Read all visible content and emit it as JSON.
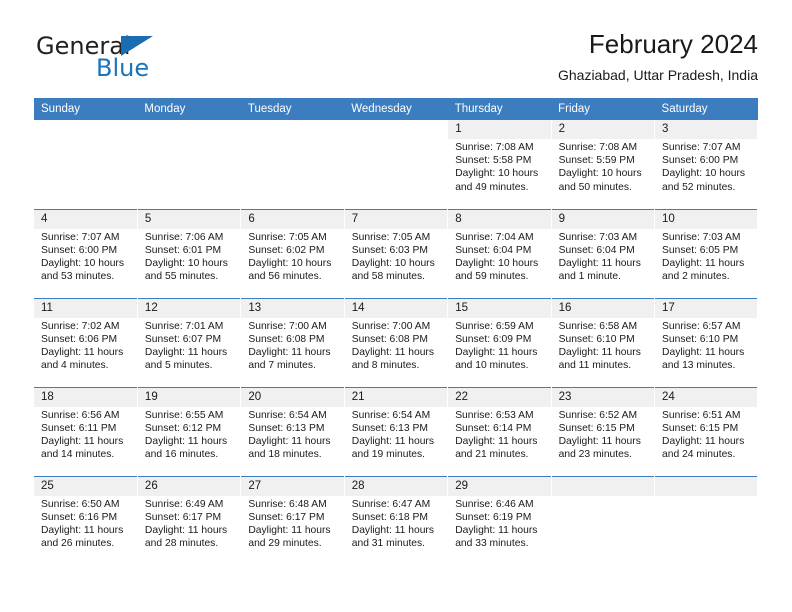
{
  "brand": {
    "word1": "General",
    "word2": "Blue",
    "flag_icon": "triangle-flag-icon",
    "accent_color": "#1b6cb0"
  },
  "header": {
    "title": "February 2024",
    "subtitle": "Ghaziabad, Uttar Pradesh, India"
  },
  "theme": {
    "header_blue": "#3b7dbf",
    "date_band_gray": "#f0f0f0",
    "divider_blue": "#3b7dbf",
    "text": "#1a1a1a"
  },
  "weekday_headers": [
    "Sunday",
    "Monday",
    "Tuesday",
    "Wednesday",
    "Thursday",
    "Friday",
    "Saturday"
  ],
  "weeks": [
    [
      {
        "date": "",
        "blank": true,
        "lines": []
      },
      {
        "date": "",
        "blank": true,
        "lines": []
      },
      {
        "date": "",
        "blank": true,
        "lines": []
      },
      {
        "date": "",
        "blank": true,
        "lines": []
      },
      {
        "date": "1",
        "lines": [
          "Sunrise: 7:08 AM",
          "Sunset: 5:58 PM",
          "Daylight: 10 hours",
          "and 49 minutes."
        ]
      },
      {
        "date": "2",
        "lines": [
          "Sunrise: 7:08 AM",
          "Sunset: 5:59 PM",
          "Daylight: 10 hours",
          "and 50 minutes."
        ]
      },
      {
        "date": "3",
        "lines": [
          "Sunrise: 7:07 AM",
          "Sunset: 6:00 PM",
          "Daylight: 10 hours",
          "and 52 minutes."
        ]
      }
    ],
    [
      {
        "date": "4",
        "lines": [
          "Sunrise: 7:07 AM",
          "Sunset: 6:00 PM",
          "Daylight: 10 hours",
          "and 53 minutes."
        ]
      },
      {
        "date": "5",
        "lines": [
          "Sunrise: 7:06 AM",
          "Sunset: 6:01 PM",
          "Daylight: 10 hours",
          "and 55 minutes."
        ]
      },
      {
        "date": "6",
        "lines": [
          "Sunrise: 7:05 AM",
          "Sunset: 6:02 PM",
          "Daylight: 10 hours",
          "and 56 minutes."
        ]
      },
      {
        "date": "7",
        "lines": [
          "Sunrise: 7:05 AM",
          "Sunset: 6:03 PM",
          "Daylight: 10 hours",
          "and 58 minutes."
        ]
      },
      {
        "date": "8",
        "lines": [
          "Sunrise: 7:04 AM",
          "Sunset: 6:04 PM",
          "Daylight: 10 hours",
          "and 59 minutes."
        ]
      },
      {
        "date": "9",
        "lines": [
          "Sunrise: 7:03 AM",
          "Sunset: 6:04 PM",
          "Daylight: 11 hours",
          "and 1 minute."
        ]
      },
      {
        "date": "10",
        "lines": [
          "Sunrise: 7:03 AM",
          "Sunset: 6:05 PM",
          "Daylight: 11 hours",
          "and 2 minutes."
        ]
      }
    ],
    [
      {
        "date": "11",
        "lines": [
          "Sunrise: 7:02 AM",
          "Sunset: 6:06 PM",
          "Daylight: 11 hours",
          "and 4 minutes."
        ]
      },
      {
        "date": "12",
        "lines": [
          "Sunrise: 7:01 AM",
          "Sunset: 6:07 PM",
          "Daylight: 11 hours",
          "and 5 minutes."
        ]
      },
      {
        "date": "13",
        "lines": [
          "Sunrise: 7:00 AM",
          "Sunset: 6:08 PM",
          "Daylight: 11 hours",
          "and 7 minutes."
        ]
      },
      {
        "date": "14",
        "lines": [
          "Sunrise: 7:00 AM",
          "Sunset: 6:08 PM",
          "Daylight: 11 hours",
          "and 8 minutes."
        ]
      },
      {
        "date": "15",
        "lines": [
          "Sunrise: 6:59 AM",
          "Sunset: 6:09 PM",
          "Daylight: 11 hours",
          "and 10 minutes."
        ]
      },
      {
        "date": "16",
        "lines": [
          "Sunrise: 6:58 AM",
          "Sunset: 6:10 PM",
          "Daylight: 11 hours",
          "and 11 minutes."
        ]
      },
      {
        "date": "17",
        "lines": [
          "Sunrise: 6:57 AM",
          "Sunset: 6:10 PM",
          "Daylight: 11 hours",
          "and 13 minutes."
        ]
      }
    ],
    [
      {
        "date": "18",
        "lines": [
          "Sunrise: 6:56 AM",
          "Sunset: 6:11 PM",
          "Daylight: 11 hours",
          "and 14 minutes."
        ]
      },
      {
        "date": "19",
        "lines": [
          "Sunrise: 6:55 AM",
          "Sunset: 6:12 PM",
          "Daylight: 11 hours",
          "and 16 minutes."
        ]
      },
      {
        "date": "20",
        "lines": [
          "Sunrise: 6:54 AM",
          "Sunset: 6:13 PM",
          "Daylight: 11 hours",
          "and 18 minutes."
        ]
      },
      {
        "date": "21",
        "lines": [
          "Sunrise: 6:54 AM",
          "Sunset: 6:13 PM",
          "Daylight: 11 hours",
          "and 19 minutes."
        ]
      },
      {
        "date": "22",
        "lines": [
          "Sunrise: 6:53 AM",
          "Sunset: 6:14 PM",
          "Daylight: 11 hours",
          "and 21 minutes."
        ]
      },
      {
        "date": "23",
        "lines": [
          "Sunrise: 6:52 AM",
          "Sunset: 6:15 PM",
          "Daylight: 11 hours",
          "and 23 minutes."
        ]
      },
      {
        "date": "24",
        "lines": [
          "Sunrise: 6:51 AM",
          "Sunset: 6:15 PM",
          "Daylight: 11 hours",
          "and 24 minutes."
        ]
      }
    ],
    [
      {
        "date": "25",
        "lines": [
          "Sunrise: 6:50 AM",
          "Sunset: 6:16 PM",
          "Daylight: 11 hours",
          "and 26 minutes."
        ]
      },
      {
        "date": "26",
        "lines": [
          "Sunrise: 6:49 AM",
          "Sunset: 6:17 PM",
          "Daylight: 11 hours",
          "and 28 minutes."
        ]
      },
      {
        "date": "27",
        "lines": [
          "Sunrise: 6:48 AM",
          "Sunset: 6:17 PM",
          "Daylight: 11 hours",
          "and 29 minutes."
        ]
      },
      {
        "date": "28",
        "lines": [
          "Sunrise: 6:47 AM",
          "Sunset: 6:18 PM",
          "Daylight: 11 hours",
          "and 31 minutes."
        ]
      },
      {
        "date": "29",
        "lines": [
          "Sunrise: 6:46 AM",
          "Sunset: 6:19 PM",
          "Daylight: 11 hours",
          "and 33 minutes."
        ]
      },
      {
        "date": "",
        "empty": true,
        "lines": []
      },
      {
        "date": "",
        "empty": true,
        "lines": []
      }
    ]
  ]
}
